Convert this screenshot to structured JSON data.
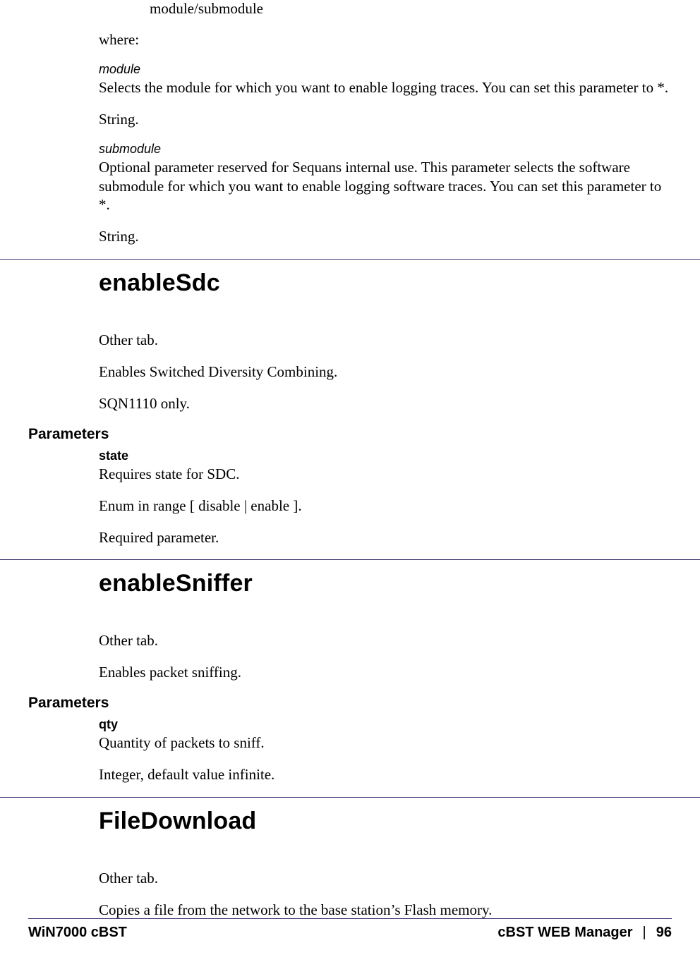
{
  "intro": {
    "synopsis": "module/submodule",
    "where": "where:",
    "module": {
      "name": "module",
      "desc": "Selects the module for which you want to enable logging traces. You can set this parameter to *.",
      "type": "String."
    },
    "submodule": {
      "name": "submodule",
      "desc": "Optional parameter reserved for Sequans internal use. This parameter selects the software submodule for which you want to enable logging software traces. You can set this parameter to *.",
      "type": "String."
    }
  },
  "enableSdc": {
    "heading": "enableSdc",
    "tab": "Other tab.",
    "desc": "Enables Switched Diversity Combining.",
    "note": "SQN1110 only.",
    "parametersLabel": "Parameters",
    "state": {
      "name": "state",
      "desc": "Requires state for SDC.",
      "type": "Enum in range [ disable | enable ].",
      "req": "Required parameter."
    }
  },
  "enableSniffer": {
    "heading": "enableSniffer",
    "tab": "Other tab.",
    "desc": "Enables packet sniffing.",
    "parametersLabel": "Parameters",
    "qty": {
      "name": "qty",
      "desc": "Quantity of packets to sniff.",
      "type": "Integer, default value infinite."
    }
  },
  "fileDownload": {
    "heading": "FileDownload",
    "tab": "Other tab.",
    "desc": "Copies a file from the network to the base station’s Flash memory."
  },
  "footer": {
    "left": "WiN7000 cBST",
    "rightTitle": "cBST WEB Manager",
    "sep": "|",
    "page": "96"
  }
}
